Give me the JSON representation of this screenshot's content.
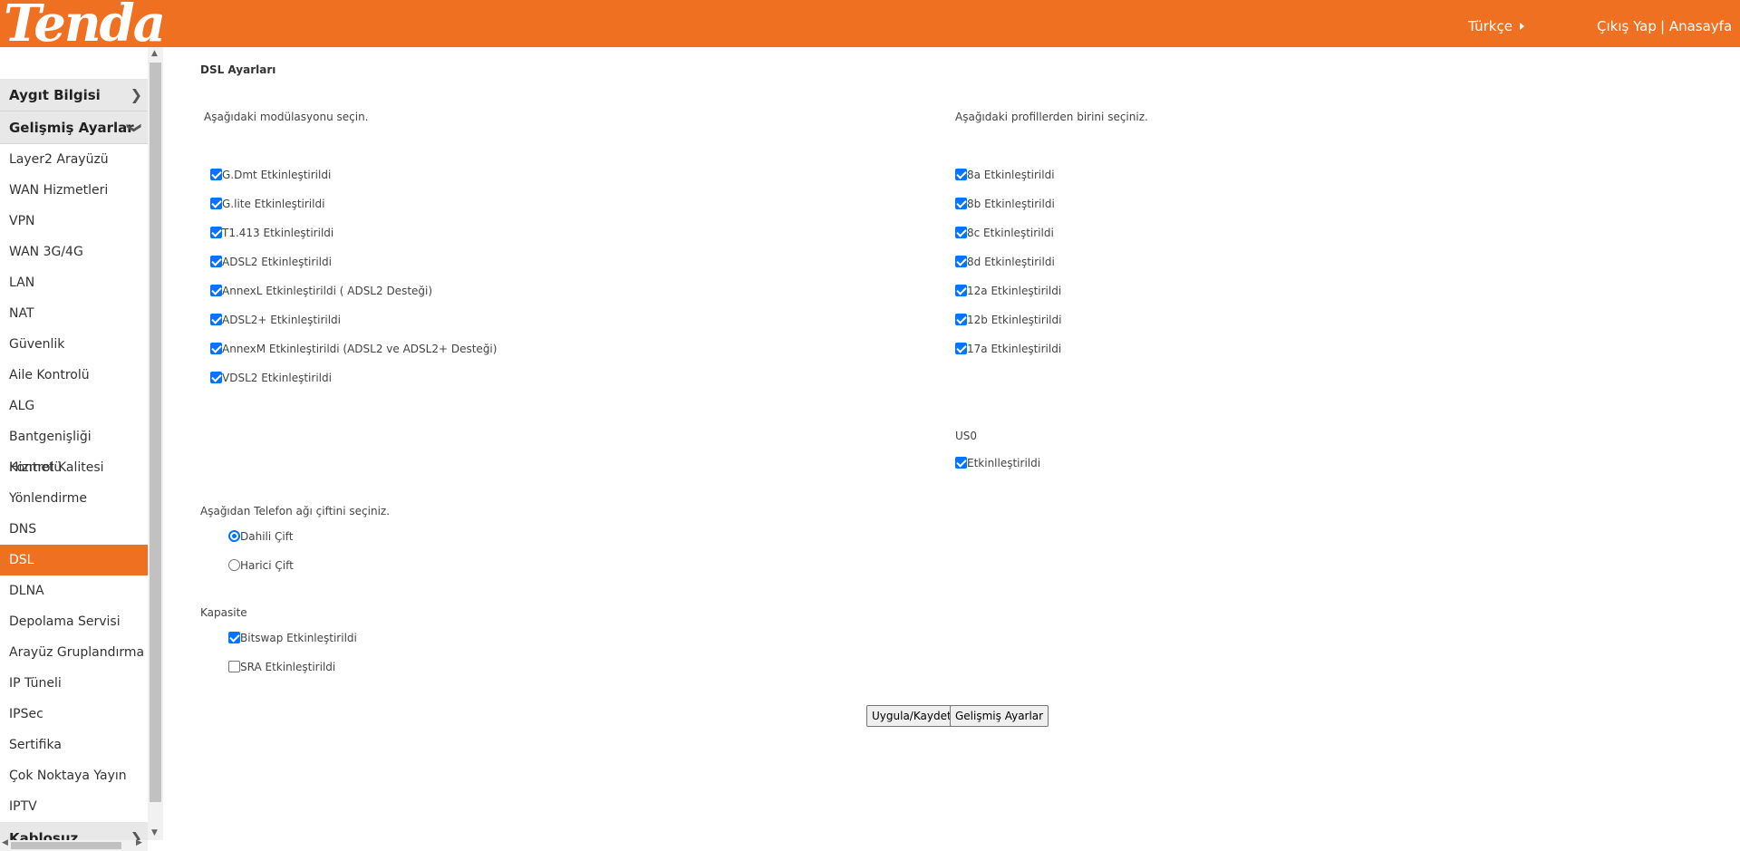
{
  "header": {
    "logo": "Tenda",
    "language": "Türkçe",
    "logout": "Çıkış Yap",
    "home": "| Anasayfa"
  },
  "sidebar": {
    "groups": {
      "device_info": "Aygıt Bilgisi",
      "advanced": "Gelişmiş Ayarlar",
      "wireless": "Kablosuz"
    },
    "items": [
      "Layer2 Arayüzü",
      "WAN Hizmetleri",
      "VPN",
      "WAN 3G/4G",
      "LAN",
      "NAT",
      "Güvenlik",
      "Aile Kontrolü",
      "ALG",
      "Bantgenişliği Kontrolü",
      "Hizmet Kalitesi",
      "Yönlendirme",
      "DNS",
      "DSL",
      "DLNA",
      "Depolama Servisi",
      "Arayüz Gruplandırma",
      "IP Tüneli",
      "IPSec",
      "Sertifika",
      "Çok Noktaya Yayın",
      "IPTV"
    ],
    "active_item": "DSL"
  },
  "main": {
    "title": "DSL Ayarları",
    "modulation_prompt": "Aşağıdaki modülasyonu seçin.",
    "profile_prompt": "Aşağıdaki profillerden birini seçiniz.",
    "modulations": [
      {
        "label": "G.Dmt Etkinleştirildi",
        "checked": true
      },
      {
        "label": "G.lite Etkinleştirildi",
        "checked": true
      },
      {
        "label": "T1.413 Etkinleştirildi",
        "checked": true
      },
      {
        "label": "ADSL2 Etkinleştirildi",
        "checked": true
      },
      {
        "label": "AnnexL Etkinleştirildi ( ADSL2 Desteği)",
        "checked": true
      },
      {
        "label": "ADSL2+ Etkinleştirildi",
        "checked": true
      },
      {
        "label": "AnnexM Etkinleştirildi (ADSL2 ve ADSL2+ Desteği)",
        "checked": true
      },
      {
        "label": "VDSL2 Etkinleştirildi",
        "checked": true
      }
    ],
    "profiles": [
      {
        "label": "8a Etkinleştirildi",
        "checked": true
      },
      {
        "label": "8b Etkinleştirildi",
        "checked": true
      },
      {
        "label": "8c Etkinleştirildi",
        "checked": true
      },
      {
        "label": "8d Etkinleştirildi",
        "checked": true
      },
      {
        "label": "12a Etkinleştirildi",
        "checked": true
      },
      {
        "label": "12b Etkinleştirildi",
        "checked": true
      },
      {
        "label": "17a Etkinleştirildi",
        "checked": true
      }
    ],
    "us0_label": "US0",
    "us0_option": {
      "label": "Etkinlleştirildi",
      "checked": true
    },
    "phone_pair_prompt": "Aşağıdan Telefon ağı çiftini seçiniz.",
    "phone_pairs": [
      {
        "label": "Dahili Çift",
        "selected": true
      },
      {
        "label": "Harici Çift",
        "selected": false
      }
    ],
    "capacity_label": "Kapasite",
    "capacity": [
      {
        "label": "Bitswap Etkinleştirildi",
        "checked": true
      },
      {
        "label": "SRA Etkinleştirildi",
        "checked": false
      }
    ],
    "apply_button": "Uygula/Kaydet",
    "advanced_button": "Gelişmiş Ayarlar"
  },
  "colors": {
    "brand": "#ee7020",
    "checkbox": "#0075ff"
  }
}
